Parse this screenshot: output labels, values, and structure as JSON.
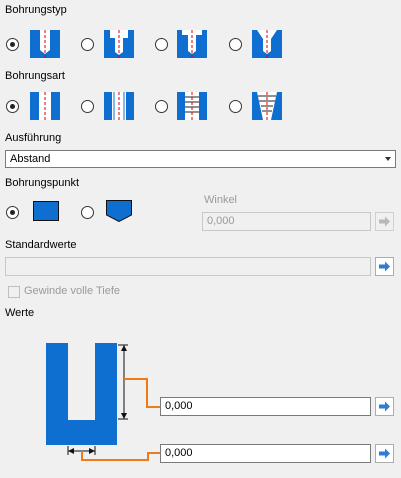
{
  "bohrungstyp": {
    "label": "Bohrungstyp",
    "options": [
      {
        "icon": "simple-hole-icon",
        "checked": true
      },
      {
        "icon": "counterbore-hole-icon",
        "checked": false
      },
      {
        "icon": "spotface-hole-icon",
        "checked": false
      },
      {
        "icon": "countersink-hole-icon",
        "checked": false
      }
    ]
  },
  "bohrungsart": {
    "label": "Bohrungsart",
    "options": [
      {
        "icon": "simple-drill-icon",
        "checked": true
      },
      {
        "icon": "clearance-hole-icon",
        "checked": false
      },
      {
        "icon": "tapped-hole-icon",
        "checked": false
      },
      {
        "icon": "taper-tapped-hole-icon",
        "checked": false
      }
    ]
  },
  "ausfuehrung": {
    "label": "Ausführung",
    "selected": "Abstand"
  },
  "bohrungspunkt": {
    "label": "Bohrungspunkt",
    "options": [
      {
        "icon": "flat-bottom-icon",
        "checked": true
      },
      {
        "icon": "angle-bottom-icon",
        "checked": false
      }
    ],
    "winkel_label": "Winkel",
    "winkel_value": "0,000"
  },
  "standardwerte": {
    "label": "Standardwerte",
    "value": ""
  },
  "gewinde": {
    "label": "Gewinde volle Tiefe",
    "checked": false
  },
  "werte": {
    "label": "Werte",
    "depth_value": "0,000",
    "diameter_value": "0,000"
  },
  "colors": {
    "hole_blue": "#0f6fd0",
    "dimension_orange": "#ee7a1a",
    "arrow_blue": "#2d7fd3"
  }
}
